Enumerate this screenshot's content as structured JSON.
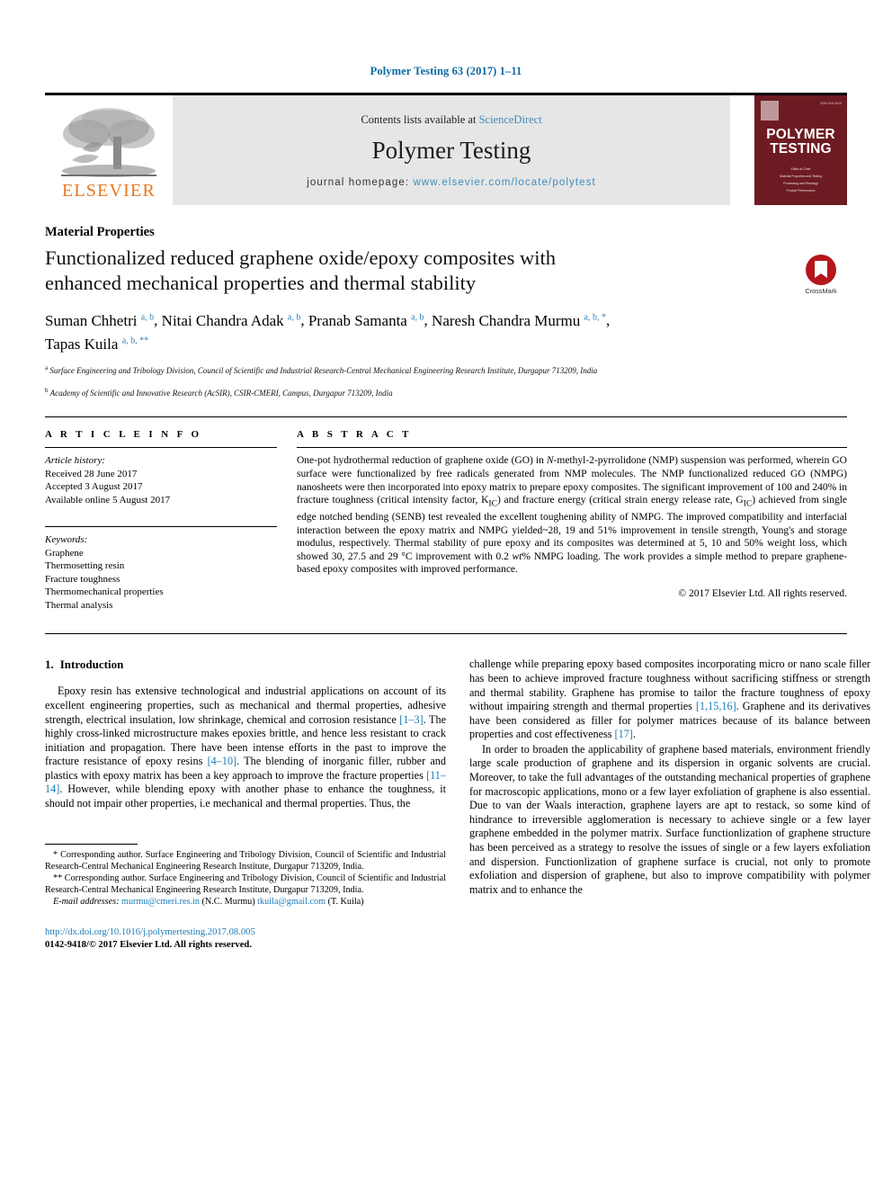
{
  "running_head": "Polymer Testing 63 (2017) 1–11",
  "masthead": {
    "publisher": "ELSEVIER",
    "contents_prefix": "Contents lists available at ",
    "contents_link": "ScienceDirect",
    "journal_name": "Polymer Testing",
    "homepage_prefix": "journal homepage: ",
    "homepage_url": "www.elsevier.com/locate/polytest",
    "cover": {
      "title_line1": "POLYMER",
      "title_line2": "TESTING",
      "corner_note": "ISSN 0142-9418",
      "credits": [
        "Editor-in-Chief",
        "Material Properties and Testing",
        "Processing and Rheology",
        "Product Performance"
      ]
    }
  },
  "article": {
    "section_label": "Material Properties",
    "title": "Functionalized reduced graphene oxide/epoxy composites with enhanced mechanical properties and thermal stability",
    "crossmark_label": "CrossMark",
    "authors": [
      {
        "name": "Suman Chhetri",
        "sup": "a, b",
        "sep": ", "
      },
      {
        "name": "Nitai Chandra Adak",
        "sup": "a, b",
        "sep": ", "
      },
      {
        "name": "Pranab Samanta",
        "sup": "a, b",
        "sep": ", "
      },
      {
        "name": "Naresh Chandra Murmu",
        "sup": "a, b, *",
        "sep": ", "
      },
      {
        "name": "Tapas Kuila",
        "sup": "a, b, **",
        "sep": ""
      }
    ],
    "affiliations": [
      {
        "marker": "a",
        "text": "Surface Engineering and Tribology Division, Council of Scientific and Industrial Research-Central Mechanical Engineering Research Institute, Durgapur 713209, India"
      },
      {
        "marker": "b",
        "text": "Academy of Scientific and Innovative Research (AcSIR), CSIR-CMERI, Campus, Durgapur 713209, India"
      }
    ]
  },
  "info": {
    "heading": "A R T I C L E  I N F O",
    "history_label": "Article history:",
    "history": [
      "Received 28 June 2017",
      "Accepted 3 August 2017",
      "Available online 5 August 2017"
    ],
    "keywords_label": "Keywords:",
    "keywords": [
      "Graphene",
      "Thermosetting resin",
      "Fracture toughness",
      "Thermomechanical properties",
      "Thermal analysis"
    ]
  },
  "abstract": {
    "heading": "A B S T R A C T",
    "text": "One-pot hydrothermal reduction of graphene oxide (GO) in N-methyl-2-pyrrolidone (NMP) suspension was performed, wherein GO surface were functionalized by free radicals generated from NMP molecules. The NMP functionalized reduced GO (NMPG) nanosheets were then incorporated into epoxy matrix to prepare epoxy composites. The significant improvement of 100 and 240% in fracture toughness (critical intensity factor, KIC) and fracture energy (critical strain energy release rate, GIC) achieved from single edge notched bending (SENB) test revealed the excellent toughening ability of NMPG. The improved compatibility and interfacial interaction between the epoxy matrix and NMPG yielded~28, 19 and 51% improvement in tensile strength, Young's and storage modulus, respectively. Thermal stability of pure epoxy and its composites was determined at 5, 10 and 50% weight loss, which showed 30, 27.5 and 29 °C improvement with 0.2 wt% NMPG loading. The work provides a simple method to prepare graphene-based epoxy composites with improved performance.",
    "copyright": "© 2017 Elsevier Ltd. All rights reserved."
  },
  "body": {
    "intro_number": "1.",
    "intro_title": "Introduction",
    "left_paragraph_1": "Epoxy resin has extensive technological and industrial applications on account of its excellent engineering properties, such as mechanical and thermal properties, adhesive strength, electrical insulation, low shrinkage, chemical and corrosion resistance [1–3]. The highly cross-linked microstructure makes epoxies brittle, and hence less resistant to crack initiation and propagation. There have been intense efforts in the past to improve the fracture resistance of epoxy resins [4–10]. The blending of inorganic filler, rubber and plastics with epoxy matrix has been a key approach to improve the fracture properties [11–14]. However, while blending epoxy with another phase to enhance the toughness, it should not impair other properties, i.e mechanical and thermal properties. Thus, the",
    "right_paragraph_1": "challenge while preparing epoxy based composites incorporating micro or nano scale filler has been to achieve improved fracture toughness without sacrificing stiffness or strength and thermal stability. Graphene has promise to tailor the fracture toughness of epoxy without impairing strength and thermal properties [1,15,16]. Graphene and its derivatives have been considered as filler for polymer matrices because of its balance between properties and cost effectiveness [17].",
    "right_paragraph_2": "In order to broaden the applicability of graphene based materials, environment friendly large scale production of graphene and its dispersion in organic solvents are crucial. Moreover, to take the full advantages of the outstanding mechanical properties of graphene for macroscopic applications, mono or a few layer exfoliation of graphene is also essential. Due to van der Waals interaction, graphene layers are apt to restack, so some kind of hindrance to irreversible agglomeration is necessary to achieve single or a few layer graphene embedded in the polymer matrix. Surface functionlization of graphene structure has been perceived as a strategy to resolve the issues of single or a few layers exfoliation and dispersion. Functionlization of graphene surface is crucial, not only to promote exfoliation and dispersion of graphene, but also to improve compatibility with polymer matrix and to enhance the"
  },
  "footnotes": {
    "note1_marker": "*",
    "note1": "Corresponding author. Surface Engineering and Tribology Division, Council of Scientific and Industrial Research-Central Mechanical Engineering Research Institute, Durgapur 713209, India.",
    "note2_marker": "**",
    "note2": "Corresponding author. Surface Engineering and Tribology Division, Council of Scientific and Industrial Research-Central Mechanical Engineering Research Institute, Durgapur 713209, India.",
    "email_label": "E-mail addresses:",
    "email1": "murmu@cmeri.res.in",
    "email1_owner": "(N.C. Murmu)",
    "email2": "tkuila@gmail.com",
    "email2_owner": "(T. Kuila)"
  },
  "footer": {
    "doi": "http://dx.doi.org/10.1016/j.polymertesting.2017.08.005",
    "issn_line": "0142-9418/© 2017 Elsevier Ltd. All rights reserved."
  },
  "colors": {
    "link_blue": "#1a7bb9",
    "elsevier_orange": "#E87722",
    "cover_maroon": "#6d1b22",
    "crossmark_red": "#b4161b"
  }
}
